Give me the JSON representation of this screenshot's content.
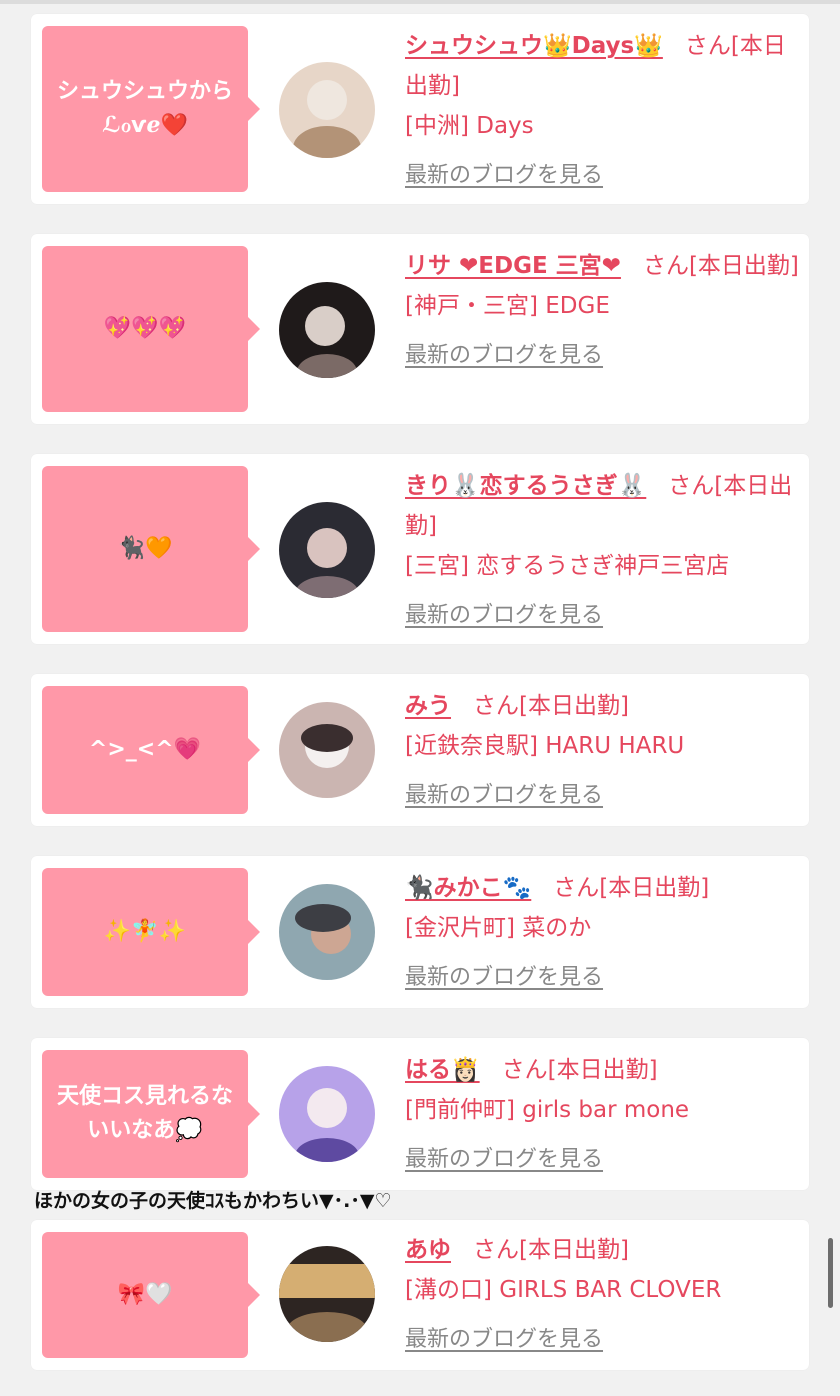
{
  "entries": [
    {
      "bubble": "シュウシュウから ℒℴѵℯ❤️",
      "name": "シュウシュウ👑Days👑",
      "suffix": "さん[本日出勤]",
      "shop": "[中洲] Days",
      "blog": "最新のブログを見る",
      "avatar_colors": [
        "#e7d6c8",
        "#b39377",
        "#efe7df"
      ]
    },
    {
      "bubble": "💖💖💖",
      "name": "リサ ❤EDGE 三宮❤",
      "suffix": "さん[本日出勤]",
      "shop": "[神戸・三宮] EDGE",
      "blog": "最新のブログを見る",
      "avatar_colors": [
        "#1f1a1a",
        "#7b6a66",
        "#d9cec8"
      ]
    },
    {
      "bubble": "🐈‍⬛🧡",
      "name": "きり🐰恋するうさぎ🐰",
      "suffix": "さん[本日出勤]",
      "shop": "[三宮] 恋するうさぎ神戸三宮店",
      "blog": "最新のブログを見る",
      "avatar_colors": [
        "#2b2b33",
        "#d9c3bf",
        "#7e6d73"
      ]
    },
    {
      "bubble": "^>_<^💗",
      "name": "みう",
      "suffix": "さん[本日出勤]",
      "shop": "[近鉄奈良駅] HARU HARU",
      "blog": "最新のブログを見る",
      "avatar_colors": [
        "#f4f0ef",
        "#3a2e2f",
        "#cbb5b1"
      ]
    },
    {
      "bubble": "✨🧚✨",
      "name": "🐈‍⬛みかこ🐾",
      "suffix": "さん[本日出勤]",
      "shop": "[金沢片町] 菜のか",
      "blog": "最新のブログを見る",
      "avatar_colors": [
        "#3d3e44",
        "#cda693",
        "#8fa7b0"
      ]
    },
    {
      "bubble": "天使コス見れるな いいなあ💭",
      "name": "はる👸🏻",
      "suffix": "さん[本日出勤]",
      "shop": "[門前仲町] girls bar mone",
      "blog": "最新のブログを見る",
      "avatar_colors": [
        "#b7a2e9",
        "#f3e9ef",
        "#5e4aa1"
      ]
    },
    {
      "bubble": "🎀🤍",
      "name": "あゆ",
      "suffix": "さん[本日出勤]",
      "shop": "[溝の口] GIRLS BAR CLOVER",
      "blog": "最新のブログを見る",
      "avatar_colors": [
        "#2d2522",
        "#d5ae72",
        "#8a6e50"
      ]
    }
  ],
  "caption": "ほかの女の子の天使ｺｽもかわちい▼･.･▼♡"
}
